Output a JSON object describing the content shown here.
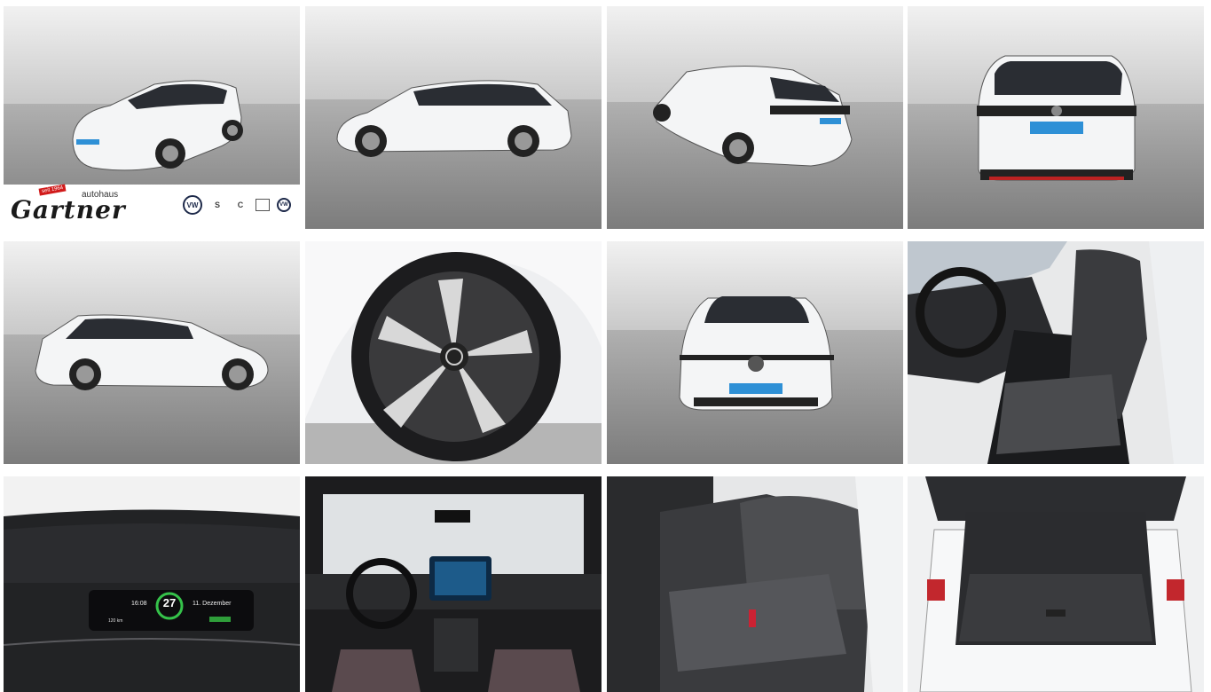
{
  "dealer": {
    "logo_text": "Gartner",
    "sub_text": "autohaus",
    "badge_text": "seit 1964",
    "brand_logos": [
      "VW",
      "S",
      "C",
      "",
      "VW"
    ]
  },
  "cluster": {
    "time": "16:08",
    "soc": "27",
    "date": "11. Dezember",
    "range": "120 km"
  },
  "colors": {
    "sky": "#ececec",
    "floor": "#8c8c8c",
    "car_white": "#f4f5f6",
    "accent_blue": "#2e90d6"
  },
  "gallery": {
    "tiles": [
      {
        "icon": "car-front-three-quarter"
      },
      {
        "icon": "car-side-left"
      },
      {
        "icon": "car-rear-three-quarter"
      },
      {
        "icon": "car-rear"
      },
      {
        "icon": "car-side-right"
      },
      {
        "icon": "wheel-closeup"
      },
      {
        "icon": "car-front"
      },
      {
        "icon": "front-seats-interior"
      },
      {
        "icon": "instrument-cluster"
      },
      {
        "icon": "dashboard-interior"
      },
      {
        "icon": "rear-seats-interior"
      },
      {
        "icon": "trunk-interior"
      }
    ]
  }
}
